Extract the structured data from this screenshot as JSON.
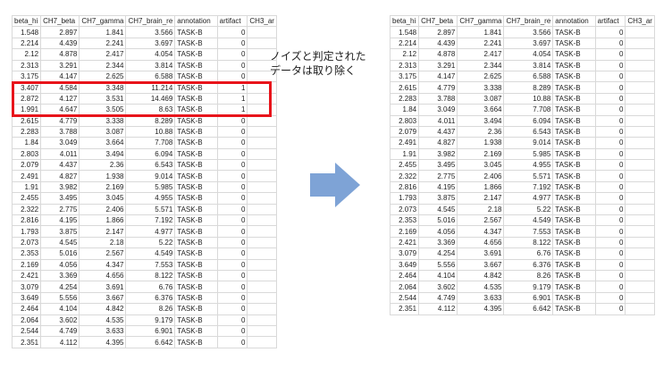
{
  "headers": [
    "beta_hi",
    "CH7_beta",
    "CH7_gamma",
    "CH7_brain_re",
    "annotation",
    "artifact",
    "CH3_ar"
  ],
  "left_rows": [
    [
      "1.548",
      "2.897",
      "1.841",
      "3.566",
      "TASK-B",
      "0"
    ],
    [
      "2.214",
      "4.439",
      "2.241",
      "3.697",
      "TASK-B",
      "0"
    ],
    [
      "2.12",
      "4.878",
      "2.417",
      "4.054",
      "TASK-B",
      "0"
    ],
    [
      "2.313",
      "3.291",
      "2.344",
      "3.814",
      "TASK-B",
      "0"
    ],
    [
      "3.175",
      "4.147",
      "2.625",
      "6.588",
      "TASK-B",
      "0"
    ],
    [
      "3.407",
      "4.584",
      "3.348",
      "11.214",
      "TASK-B",
      "1"
    ],
    [
      "2.872",
      "4.127",
      "3.531",
      "14.469",
      "TASK-B",
      "1"
    ],
    [
      "1.991",
      "4.647",
      "3.505",
      "8.63",
      "TASK-B",
      "1"
    ],
    [
      "2.615",
      "4.779",
      "3.338",
      "8.289",
      "TASK-B",
      "0"
    ],
    [
      "2.283",
      "3.788",
      "3.087",
      "10.88",
      "TASK-B",
      "0"
    ],
    [
      "1.84",
      "3.049",
      "3.664",
      "7.708",
      "TASK-B",
      "0"
    ],
    [
      "2.803",
      "4.011",
      "3.494",
      "6.094",
      "TASK-B",
      "0"
    ],
    [
      "2.079",
      "4.437",
      "2.36",
      "6.543",
      "TASK-B",
      "0"
    ],
    [
      "2.491",
      "4.827",
      "1.938",
      "9.014",
      "TASK-B",
      "0"
    ],
    [
      "1.91",
      "3.982",
      "2.169",
      "5.985",
      "TASK-B",
      "0"
    ],
    [
      "2.455",
      "3.495",
      "3.045",
      "4.955",
      "TASK-B",
      "0"
    ],
    [
      "2.322",
      "2.775",
      "2.406",
      "5.571",
      "TASK-B",
      "0"
    ],
    [
      "2.816",
      "4.195",
      "1.866",
      "7.192",
      "TASK-B",
      "0"
    ],
    [
      "1.793",
      "3.875",
      "2.147",
      "4.977",
      "TASK-B",
      "0"
    ],
    [
      "2.073",
      "4.545",
      "2.18",
      "5.22",
      "TASK-B",
      "0"
    ],
    [
      "2.353",
      "5.016",
      "2.567",
      "4.549",
      "TASK-B",
      "0"
    ],
    [
      "2.169",
      "4.056",
      "4.347",
      "7.553",
      "TASK-B",
      "0"
    ],
    [
      "2.421",
      "3.369",
      "4.656",
      "8.122",
      "TASK-B",
      "0"
    ],
    [
      "3.079",
      "4.254",
      "3.691",
      "6.76",
      "TASK-B",
      "0"
    ],
    [
      "3.649",
      "5.556",
      "3.667",
      "6.376",
      "TASK-B",
      "0"
    ],
    [
      "2.464",
      "4.104",
      "4.842",
      "8.26",
      "TASK-B",
      "0"
    ],
    [
      "2.064",
      "3.602",
      "4.535",
      "9.179",
      "TASK-B",
      "0"
    ],
    [
      "2.544",
      "4.749",
      "3.633",
      "6.901",
      "TASK-B",
      "0"
    ],
    [
      "2.351",
      "4.112",
      "4.395",
      "6.642",
      "TASK-B",
      "0"
    ]
  ],
  "right_rows": [
    [
      "1.548",
      "2.897",
      "1.841",
      "3.566",
      "TASK-B",
      "0"
    ],
    [
      "2.214",
      "4.439",
      "2.241",
      "3.697",
      "TASK-B",
      "0"
    ],
    [
      "2.12",
      "4.878",
      "2.417",
      "4.054",
      "TASK-B",
      "0"
    ],
    [
      "2.313",
      "3.291",
      "2.344",
      "3.814",
      "TASK-B",
      "0"
    ],
    [
      "3.175",
      "4.147",
      "2.625",
      "6.588",
      "TASK-B",
      "0"
    ],
    [
      "2.615",
      "4.779",
      "3.338",
      "8.289",
      "TASK-B",
      "0"
    ],
    [
      "2.283",
      "3.788",
      "3.087",
      "10.88",
      "TASK-B",
      "0"
    ],
    [
      "1.84",
      "3.049",
      "3.664",
      "7.708",
      "TASK-B",
      "0"
    ],
    [
      "2.803",
      "4.011",
      "3.494",
      "6.094",
      "TASK-B",
      "0"
    ],
    [
      "2.079",
      "4.437",
      "2.36",
      "6.543",
      "TASK-B",
      "0"
    ],
    [
      "2.491",
      "4.827",
      "1.938",
      "9.014",
      "TASK-B",
      "0"
    ],
    [
      "1.91",
      "3.982",
      "2.169",
      "5.985",
      "TASK-B",
      "0"
    ],
    [
      "2.455",
      "3.495",
      "3.045",
      "4.955",
      "TASK-B",
      "0"
    ],
    [
      "2.322",
      "2.775",
      "2.406",
      "5.571",
      "TASK-B",
      "0"
    ],
    [
      "2.816",
      "4.195",
      "1.866",
      "7.192",
      "TASK-B",
      "0"
    ],
    [
      "1.793",
      "3.875",
      "2.147",
      "4.977",
      "TASK-B",
      "0"
    ],
    [
      "2.073",
      "4.545",
      "2.18",
      "5.22",
      "TASK-B",
      "0"
    ],
    [
      "2.353",
      "5.016",
      "2.567",
      "4.549",
      "TASK-B",
      "0"
    ],
    [
      "2.169",
      "4.056",
      "4.347",
      "7.553",
      "TASK-B",
      "0"
    ],
    [
      "2.421",
      "3.369",
      "4.656",
      "8.122",
      "TASK-B",
      "0"
    ],
    [
      "3.079",
      "4.254",
      "3.691",
      "6.76",
      "TASK-B",
      "0"
    ],
    [
      "3.649",
      "5.556",
      "3.667",
      "6.376",
      "TASK-B",
      "0"
    ],
    [
      "2.464",
      "4.104",
      "4.842",
      "8.26",
      "TASK-B",
      "0"
    ],
    [
      "2.064",
      "3.602",
      "4.535",
      "9.179",
      "TASK-B",
      "0"
    ],
    [
      "2.544",
      "4.749",
      "3.633",
      "6.901",
      "TASK-B",
      "0"
    ],
    [
      "2.351",
      "4.112",
      "4.395",
      "6.642",
      "TASK-B",
      "0"
    ]
  ],
  "note": {
    "line1": "ノイズと判定された",
    "line2": "データは取り除く"
  },
  "colors": {
    "highlight": "#e8141b",
    "arrow": "#7ea3d6",
    "grid": "#d9d9d9"
  },
  "icons": {
    "arrow": "right-arrow-icon"
  }
}
